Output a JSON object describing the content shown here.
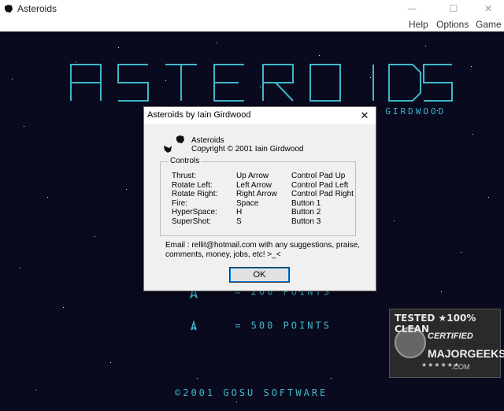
{
  "window": {
    "title": "Asteroids",
    "minimize_glyph": "—",
    "maximize_glyph": "☐",
    "close_glyph": "✕"
  },
  "menu": {
    "items": [
      "Help",
      "Options",
      "Game"
    ]
  },
  "game": {
    "byline": "N GIRDWOOD",
    "score_rows": [
      {
        "icon": "small-ship-icon",
        "text": "= 200 POINTS"
      },
      {
        "icon": "tiny-ship-icon",
        "text": "= 500 POINTS"
      }
    ],
    "copyright": "©2001 GOSU SOFTWARE",
    "accent_color": "#3fb7c9"
  },
  "watermark": {
    "line1": "TESTED ★100% CLEAN",
    "line2": "CERTIFIED",
    "line3": "MAJORGEEKS",
    "line4": ".COM",
    "stars": "★★★★★★"
  },
  "dialog": {
    "title": "Asteroids by Iain Girdwood",
    "app_name": "Asteroids",
    "copyright": "Copyright © 2001 Iain Girdwood",
    "controls_label": "Controls",
    "controls": [
      {
        "action": "Thrust:",
        "key": "Up Arrow",
        "pad": "Control Pad Up"
      },
      {
        "action": "Rotate Left:",
        "key": "Left Arrow",
        "pad": "Control Pad Left"
      },
      {
        "action": "Rotate Right:",
        "key": "Right Arrow",
        "pad": "Control Pad Right"
      },
      {
        "action": "Fire:",
        "key": "Space",
        "pad": "Button 1"
      },
      {
        "action": "HyperSpace:",
        "key": "H",
        "pad": "Button 2"
      },
      {
        "action": "SuperShot:",
        "key": "S",
        "pad": "Button 3"
      }
    ],
    "email_line1": "Email : rellit@hotmail.com with any suggestions, praise,",
    "email_line2": "comments, money, jobs,  etc!  >_<",
    "ok_label": "OK",
    "close_glyph": "✕"
  }
}
